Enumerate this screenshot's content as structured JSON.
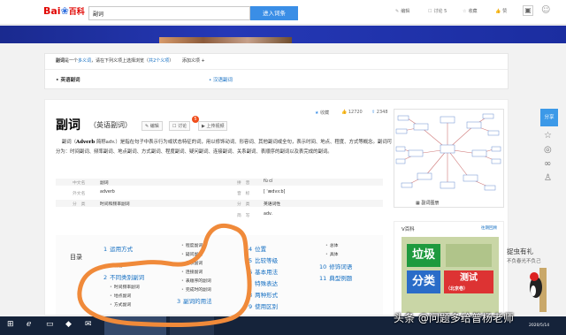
{
  "topbar": {
    "logo_main": "Bai",
    "logo_paw": "❀",
    "logo_sub": "百科",
    "search_value": "副词",
    "enter_label": "进入词条",
    "actions": [
      {
        "icon": "edit-icon",
        "label": "编辑"
      },
      {
        "icon": "discuss-icon",
        "label": "讨论 5"
      },
      {
        "icon": "star-icon",
        "label": "收藏"
      },
      {
        "icon": "thumbs-up-icon",
        "label": "赞"
      }
    ]
  },
  "disambiguation": {
    "text_prefix": "副词",
    "text_mid": "是一个",
    "multi_link": "多义词",
    "text_suffix": "，请在下列义项上选择浏览（",
    "count_link": "共2个义项",
    "text_end": "）",
    "add_label": "添加义项 +",
    "options": [
      "英语副词",
      "汉语副词"
    ]
  },
  "article": {
    "title": "副词",
    "subtitle": "（英语副词）",
    "edit_label": "编辑",
    "discuss_label": "讨论",
    "discuss_badge": "5",
    "upload_label": "上传视频",
    "collect_label": "收藏",
    "like_count": "12720",
    "share_count": "2348",
    "summary_lead": "副词（",
    "summary_term": "Adverb",
    "summary_rest": " 简称adv.）是指在句子中表示行为或状态特征的词，用以修饰动词、形容词、其他副词或全句，表示时间、地点、程度、方式等概念。副词可分为：时间副词、频率副词、地点副词、方式副词、程度副词、疑问副词、连接副词、关系副词、表顺序的副词以及表完成的副词。"
  },
  "basic_info": {
    "left": [
      {
        "k": "中文名",
        "v": "副词"
      },
      {
        "k": "外文名",
        "v": "adverb"
      },
      {
        "k": "分　类",
        "v": "时间和频率副词"
      }
    ],
    "right": [
      {
        "k": "拼　音",
        "v": "fù cí"
      },
      {
        "k": "音　标",
        "v": "[ ˈædvɜːb]"
      },
      {
        "k": "分　类",
        "v": "英语词性"
      },
      {
        "k": "简　写",
        "v": "adv."
      }
    ]
  },
  "image_caption": "副词图册",
  "catalog": {
    "title": "目录",
    "col1": [
      {
        "n": "1",
        "label": "运用方式",
        "subs": [
          "功能"
        ]
      },
      {
        "n": "2",
        "label": "不同类别副词",
        "subs": [
          "时间频率副词",
          "地点副词",
          "方式副词"
        ]
      }
    ],
    "col2_subs": [
      "程度副词",
      "疑问副词",
      "关系副词",
      "连接副词",
      "表顺序的副词",
      "完成时的副词"
    ],
    "col2_item": {
      "n": "3",
      "label": "副词的用法"
    },
    "col3": [
      {
        "n": "4",
        "label": "位置"
      },
      {
        "n": "5",
        "label": "比较等级"
      },
      {
        "n": "6",
        "label": "基本用法"
      },
      {
        "n": "7",
        "label": "特殊表达"
      },
      {
        "n": "8",
        "label": "两种形式"
      },
      {
        "n": "9",
        "label": "使用区别"
      }
    ],
    "col4_subs": [
      "总体",
      "具体"
    ],
    "col4": [
      {
        "n": "10",
        "label": "修饰词语"
      },
      {
        "n": "11",
        "label": "典型例题"
      }
    ]
  },
  "vbaike": {
    "title": "V百科",
    "more": "往期回顾",
    "card_title_1": "垃圾",
    "card_title_2": "分类",
    "card_title_3": "测试",
    "card_sub": "（北京卷）"
  },
  "side": {
    "share_label": "分享"
  },
  "ad": {
    "line1": "捉虫有礼",
    "line2": "不负春光不负己"
  },
  "taskbar": {
    "watermark": "头条 @问题多给普杨老师",
    "date": "2020/5/14"
  },
  "colors": {
    "accent": "#3a8ee6",
    "link": "#136ec2",
    "annotation": "#f08a3a"
  }
}
